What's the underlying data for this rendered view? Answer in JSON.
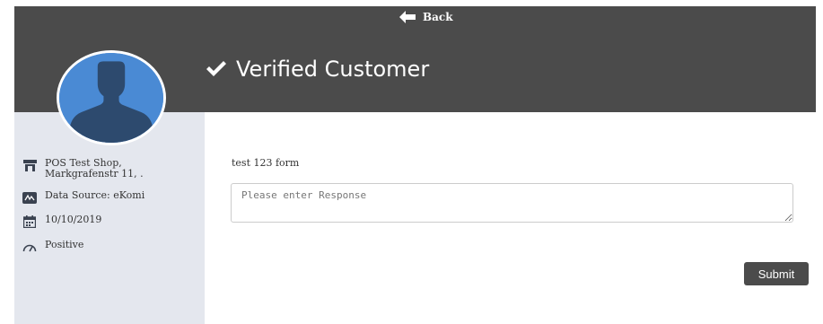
{
  "header": {
    "back_label": "Back",
    "title": "Verified Customer"
  },
  "sidebar": {
    "shop": "POS Test Shop,",
    "address": "Markgrafenstr 11, .",
    "data_source": "Data Source: eKomi",
    "date": "10/10/2019",
    "sentiment": "Positive"
  },
  "form": {
    "label": "test 123 form",
    "response_placeholder": "Please enter Response",
    "response_value": "",
    "submit_label": "Submit"
  },
  "colors": {
    "header_bg": "#4b4b4b",
    "sidebar_bg": "#e4e7ee",
    "avatar_bg": "#4a8ad4",
    "avatar_silhouette": "#2d4a6e"
  },
  "icons": {
    "back": "arrow-left-icon",
    "title": "checkmark-icon",
    "shop": "store-icon",
    "source": "ekomi-icon",
    "date": "calendar-icon",
    "sentiment": "gauge-icon"
  }
}
